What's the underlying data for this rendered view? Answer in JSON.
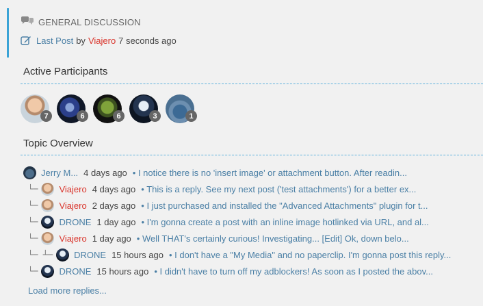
{
  "header": {
    "forum_title": "GENERAL DISCUSSION",
    "last_post_label": "Last Post",
    "by_label": "by",
    "last_post_author": "Viajero",
    "last_post_time": "7 seconds ago"
  },
  "participants": {
    "title": "Active Participants",
    "items": [
      {
        "count": "7",
        "avatar": "man-portrait"
      },
      {
        "count": "6",
        "avatar": "robot-figure"
      },
      {
        "count": "6",
        "avatar": "green-face"
      },
      {
        "count": "3",
        "avatar": "pilot-helmet"
      },
      {
        "count": "1",
        "avatar": "blue-scene"
      }
    ]
  },
  "overview": {
    "title": "Topic Overview",
    "replies": [
      {
        "tree": "",
        "author": "Jerry M...",
        "author_color": "link",
        "time": "4 days ago",
        "excerpt": "• I notice there is no 'insert image' or attachment button. After readin..."
      },
      {
        "tree": "└─",
        "author": "Viajero",
        "author_color": "red",
        "time": "4 days ago",
        "excerpt": "• This is a reply. See my next post ('test attachments') for a better ex..."
      },
      {
        "tree": "└─",
        "author": "Viajero",
        "author_color": "red",
        "time": "2 days ago",
        "excerpt": "• I just purchased and installed the \"Advanced Attachments\" plugin for t..."
      },
      {
        "tree": "└─",
        "author": "DRONE",
        "author_color": "link",
        "time": "1 day ago",
        "excerpt": "• I'm gonna create a post with an inline image hotlinked via URL, and al..."
      },
      {
        "tree": "└─",
        "author": "Viajero",
        "author_color": "red",
        "time": "1 day ago",
        "excerpt": "• Well THAT's certainly curious! Investigating... [Edit] Ok, down belo..."
      },
      {
        "tree": "└─ ┴─",
        "author": "DRONE",
        "author_color": "link",
        "time": "15 hours ago",
        "excerpt": "• I don't have a \"My Media\" and no paperclip. I'm gonna post this reply..."
      },
      {
        "tree": "└─",
        "author": "DRONE",
        "author_color": "link",
        "time": "15 hours ago",
        "excerpt": "• I didn't have to turn off my adblockers! As soon as I posted the abov..."
      }
    ],
    "load_more": "Load more replies..."
  },
  "colors": {
    "accent": "#3aa3d6",
    "link": "#4a7fa5",
    "author_red": "#d9342b"
  }
}
